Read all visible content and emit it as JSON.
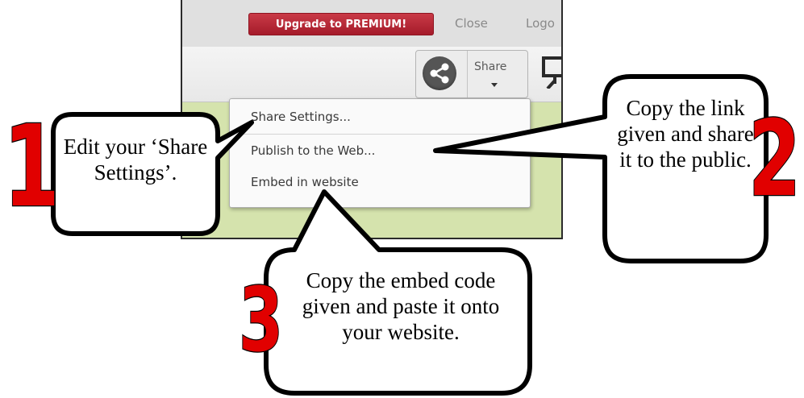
{
  "topbar": {
    "upgrade_label": "Upgrade to PREMIUM!",
    "close_label": "Close",
    "logout_label": "Logo"
  },
  "toolbar": {
    "share_icon": "share-icon",
    "share_label": "Share",
    "present_icon": "presentation-icon"
  },
  "share_menu": {
    "items": [
      {
        "label": "Share Settings..."
      },
      {
        "label": "Publish to the Web..."
      },
      {
        "label": "Embed in website"
      }
    ]
  },
  "callouts": [
    {
      "number": "1",
      "text": "Edit your ‘Share Settings’."
    },
    {
      "number": "2",
      "text": "Copy the link given and share it to the public."
    },
    {
      "number": "3",
      "text": "Copy the embed code given and paste it onto your website."
    }
  ],
  "colors": {
    "upgrade_red": "#b2232f",
    "number_red": "#e10000",
    "canvas_green": "#d5e3ad"
  }
}
